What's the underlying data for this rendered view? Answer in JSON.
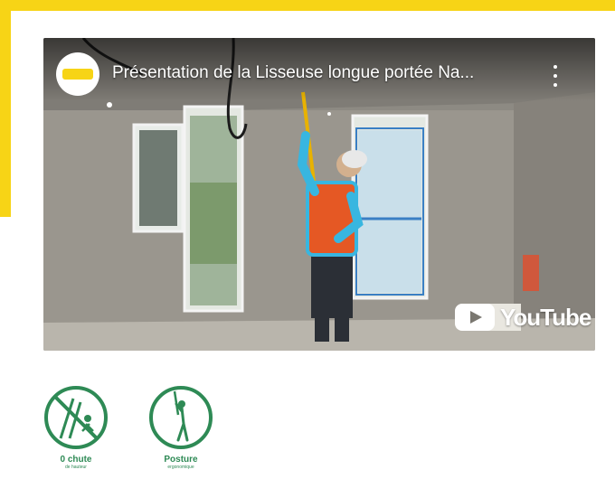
{
  "video": {
    "title": "Présentation de la Lisseuse longue portée Na...",
    "channel_avatar_icon": "channel-logo-icon",
    "more_icon": "more-vert-icon",
    "platform_logo_text": "YouTube"
  },
  "badges": [
    {
      "icon": "no-fall-icon",
      "label": "0 chute",
      "sub": "de hauteur"
    },
    {
      "icon": "ergonomic-posture-icon",
      "label": "Posture",
      "sub": "ergonomique"
    }
  ],
  "colors": {
    "frame_yellow": "#f7d416",
    "badge_green": "#2e8a55"
  }
}
